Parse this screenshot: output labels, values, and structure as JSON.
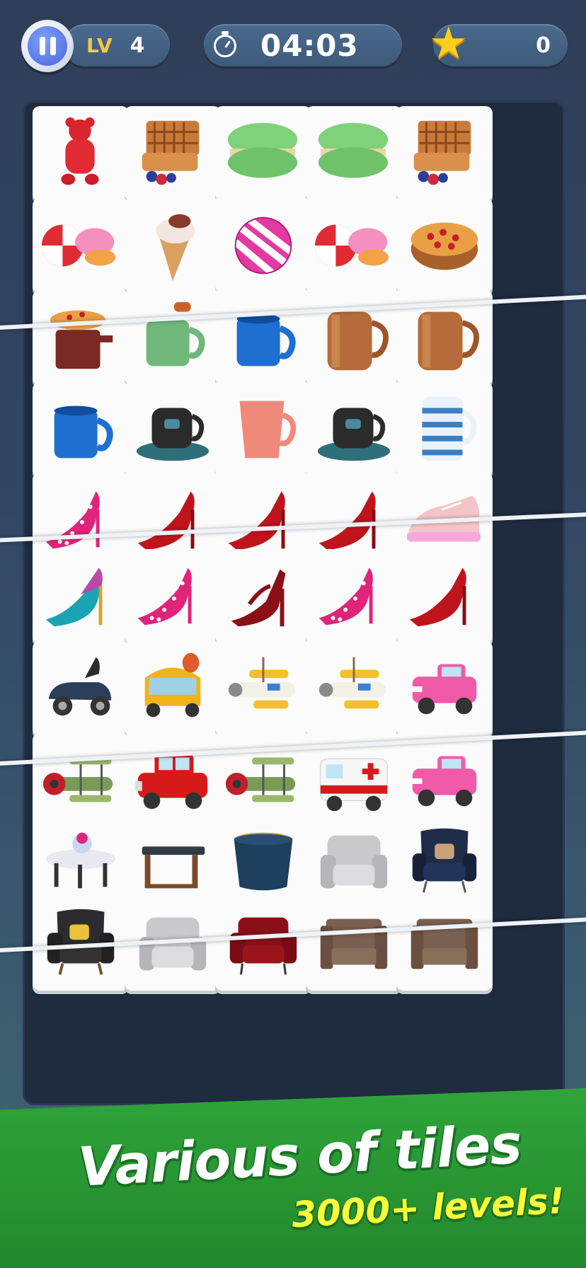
{
  "hud": {
    "level_label": "LV",
    "level_number": "4",
    "timer": "04:03",
    "stars": "0"
  },
  "board": {
    "rows": [
      [
        "gummy-bear",
        "waffle",
        "macaron",
        "macaron",
        "waffle"
      ],
      [
        "peppermint-candy",
        "ice-cream-cone",
        "candy-ball",
        "peppermint-candy",
        "fruit-pie"
      ],
      [
        "pie-cup",
        "green-mug",
        "blue-mug",
        "copper-mug",
        "copper-mug"
      ],
      [
        "blue-mug",
        "coffee-cup-saucer",
        "pink-mug",
        "coffee-cup-saucer",
        "striped-mug"
      ],
      [
        "polka-dot-heel",
        "red-heel",
        "red-heel",
        "red-heel",
        "pink-sneaker"
      ],
      [
        "teal-heel",
        "polka-dot-heel",
        "red-sandal-heel",
        "polka-dot-heel",
        "red-heel"
      ],
      [
        "toy-car",
        "tuk-tuk",
        "toy-plane",
        "toy-plane",
        "pink-truck"
      ],
      [
        "biplane",
        "red-truck",
        "biplane",
        "ambulance",
        "pink-truck"
      ],
      [
        "coffee-table",
        "side-table",
        "pouf",
        "grey-armchair",
        "navy-armchair"
      ],
      [
        "black-armchair",
        "grey-armchair",
        "red-armchair",
        "brown-armchair",
        "brown-armchair"
      ]
    ]
  },
  "banner": {
    "title": "Various of tiles",
    "subtitle": "3000+ levels!"
  },
  "colors": {
    "accent_gold": "#f6c64a",
    "banner_green": "#2fa43a",
    "subtitle_yellow": "#f7ff3a"
  }
}
